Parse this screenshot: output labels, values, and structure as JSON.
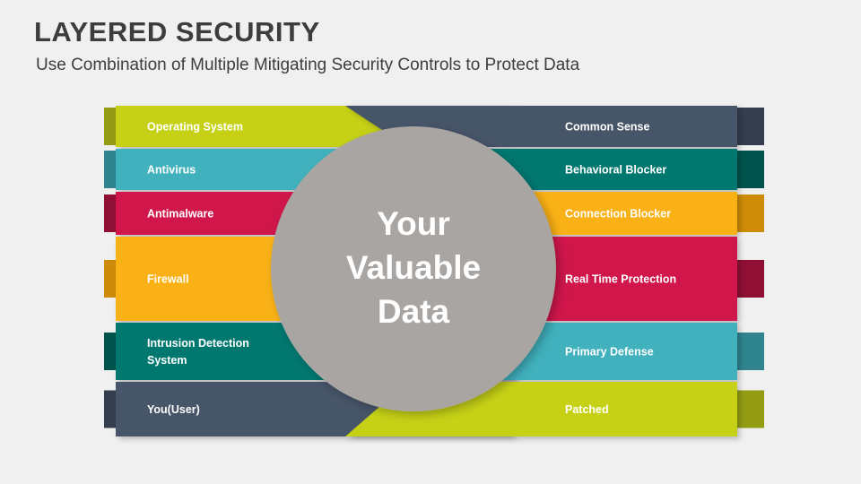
{
  "header": {
    "title": "LAYERED SECURITY",
    "subtitle": "Use Combination of Multiple Mitigating Security Controls to Protect Data"
  },
  "center": {
    "name": "center-circle",
    "line1": "Your",
    "line2": "Valuable",
    "line3": "Data",
    "fill": "#a9a5a2",
    "text_color": "#ffffff"
  },
  "colors": {
    "background": "#f0f0f0",
    "title_text": "#3d3d3d",
    "lime": "#c6d117",
    "lime_dark": "#949c13",
    "cyan": "#3fb1bd",
    "cyan_dark": "#2f848e",
    "crimson": "#d0164b",
    "crimson_dark": "#8f0f35",
    "amber": "#f9b115",
    "amber_dark": "#cd8b07",
    "teal": "#00786f",
    "teal_dark": "#00534d",
    "slate": "#475569",
    "slate_dark": "#333d4d"
  },
  "left_layers": [
    {
      "label": "Operating System",
      "color": "#c6d117",
      "tab_color": "#949c13",
      "shape": "taper-top"
    },
    {
      "label": "Antivirus",
      "color": "#3fb1bd",
      "tab_color": "#2f848e",
      "shape": "rect"
    },
    {
      "label": "Antimalware",
      "color": "#d0164b",
      "tab_color": "#8f0f35",
      "shape": "rect"
    },
    {
      "label": "Firewall",
      "color": "#f9b115",
      "tab_color": "#cd8b07",
      "shape": "rect"
    },
    {
      "label": "Intrusion Detection\nSystem",
      "color": "#00786f",
      "tab_color": "#00534d",
      "shape": "rect"
    },
    {
      "label": "You(User)",
      "color": "#475569",
      "tab_color": "#333d4d",
      "shape": "taper-bottom"
    }
  ],
  "right_layers": [
    {
      "label": "Common Sense",
      "color": "#475569",
      "tab_color": "#333d4d",
      "shape": "taper-top"
    },
    {
      "label": "Behavioral Blocker",
      "color": "#00786f",
      "tab_color": "#00534d",
      "shape": "rect"
    },
    {
      "label": "Connection Blocker",
      "color": "#f9b115",
      "tab_color": "#cd8b07",
      "shape": "rect"
    },
    {
      "label": "Real Time Protection",
      "color": "#d0164b",
      "tab_color": "#8f0f35",
      "shape": "rect"
    },
    {
      "label": "Primary Defense",
      "color": "#3fb1bd",
      "tab_color": "#2f848e",
      "shape": "rect"
    },
    {
      "label": "Patched",
      "color": "#c6d117",
      "tab_color": "#949c13",
      "shape": "taper-bottom"
    }
  ]
}
